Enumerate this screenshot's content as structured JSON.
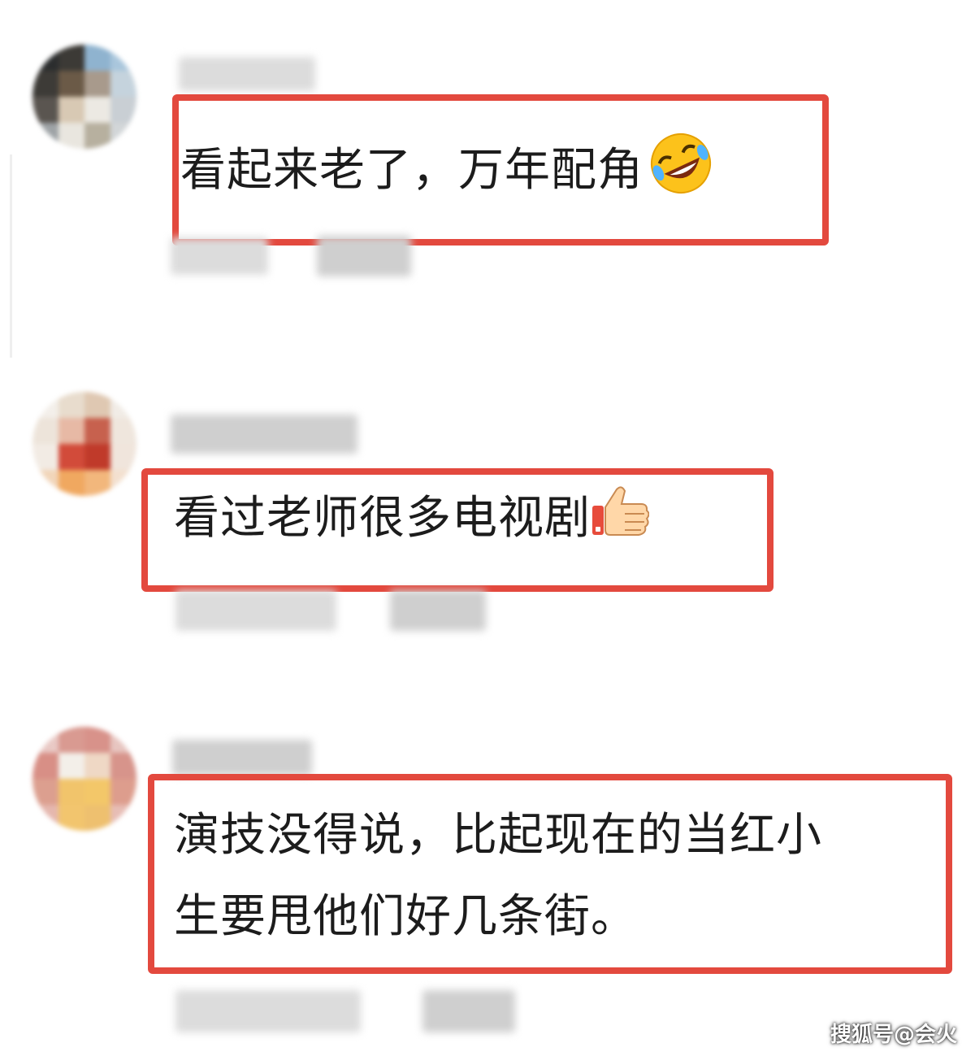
{
  "comments": [
    {
      "text_lines": [
        "看起来老了，万年配角"
      ],
      "emoji": "rolling-laughing-emoji"
    },
    {
      "text_lines": [
        "看过老师很多电视剧"
      ],
      "emoji": "thumbs-up-emoji"
    },
    {
      "text_lines": [
        "演技没得说，比起现在的当红小",
        "生要甩他们好几条街。"
      ],
      "emoji": ""
    }
  ],
  "watermark": "搜狐号@会火",
  "colors": {
    "highlight_border": "#e3493e",
    "text": "#1c1c1c",
    "background": "#ffffff"
  }
}
